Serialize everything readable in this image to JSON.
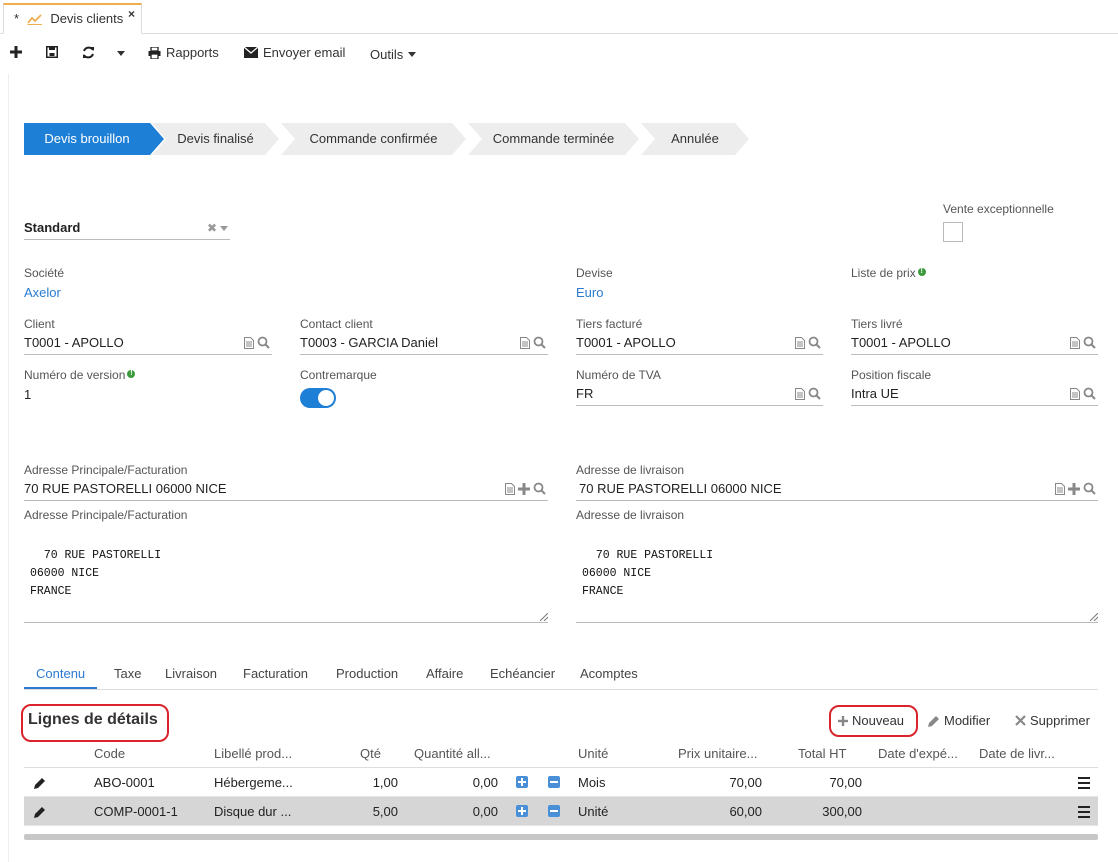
{
  "tab": {
    "modified_mark": "*",
    "title": "Devis clients",
    "close": "×"
  },
  "toolbar": {
    "reports_label": "Rapports",
    "email_label": "Envoyer email",
    "tools_label": "Outils"
  },
  "status_steps": [
    "Devis brouillon",
    "Devis finalisé",
    "Commande confirmée",
    "Commande terminée",
    "Annulée"
  ],
  "status_active_index": 0,
  "colors": {
    "accent": "#1e7fd6",
    "step_inactive": "#ededed",
    "highlight": "#d9242d"
  },
  "form": {
    "type_select": "Standard",
    "vente_exceptionnelle_label": "Vente exceptionnelle",
    "societe_label": "Société",
    "societe_value": "Axelor",
    "devise_label": "Devise",
    "devise_value": "Euro",
    "liste_prix_label": "Liste de prix",
    "client_label": "Client",
    "client_value": "T0001 - APOLLO",
    "contact_label": "Contact client",
    "contact_value": "T0003 - GARCIA Daniel",
    "tiers_facture_label": "Tiers facturé",
    "tiers_facture_value": "T0001 - APOLLO",
    "tiers_livre_label": "Tiers livré",
    "tiers_livre_value": "T0001 - APOLLO",
    "version_label": "Numéro de version",
    "version_value": "1",
    "contremarque_label": "Contremarque",
    "tva_label": "Numéro de TVA",
    "tva_value": "FR",
    "position_fiscale_label": "Position fiscale",
    "position_fiscale_value": "Intra UE",
    "adresse_princ_label": "Adresse Principale/Facturation",
    "adresse_princ_value": "70 RUE PASTORELLI 06000 NICE",
    "adresse_livr_label": "Adresse de livraison",
    "adresse_livr_value": "70 RUE PASTORELLI 06000 NICE",
    "adresse_princ_text_label": "Adresse Principale/Facturation",
    "adresse_princ_text": "70 RUE PASTORELLI\n06000 NICE\nFRANCE",
    "adresse_livr_text_label": "Adresse de livraison",
    "adresse_livr_text": "70 RUE PASTORELLI\n06000 NICE\nFRANCE"
  },
  "form_tabs": [
    "Contenu",
    "Taxe",
    "Livraison",
    "Facturation",
    "Production",
    "Affaire",
    "Echéancier",
    "Acomptes"
  ],
  "grid": {
    "title": "Lignes de détails",
    "new_label": "Nouveau",
    "edit_label": "Modifier",
    "delete_label": "Supprimer",
    "columns": [
      "Code",
      "Libellé prod...",
      "Qté",
      "Quantité all...",
      "Unité",
      "Prix unitaire...",
      "Total HT",
      "Date d'expé...",
      "Date de livr..."
    ],
    "rows": [
      {
        "code": "ABO-0001",
        "libelle": "Hébergeme...",
        "qte": "1,00",
        "qte_all": "0,00",
        "unite": "Mois",
        "prix": "70,00",
        "total": "70,00"
      },
      {
        "code": "COMP-0001-1",
        "libelle": "Disque dur ...",
        "qte": "5,00",
        "qte_all": "0,00",
        "unite": "Unité",
        "prix": "60,00",
        "total": "300,00"
      }
    ]
  }
}
